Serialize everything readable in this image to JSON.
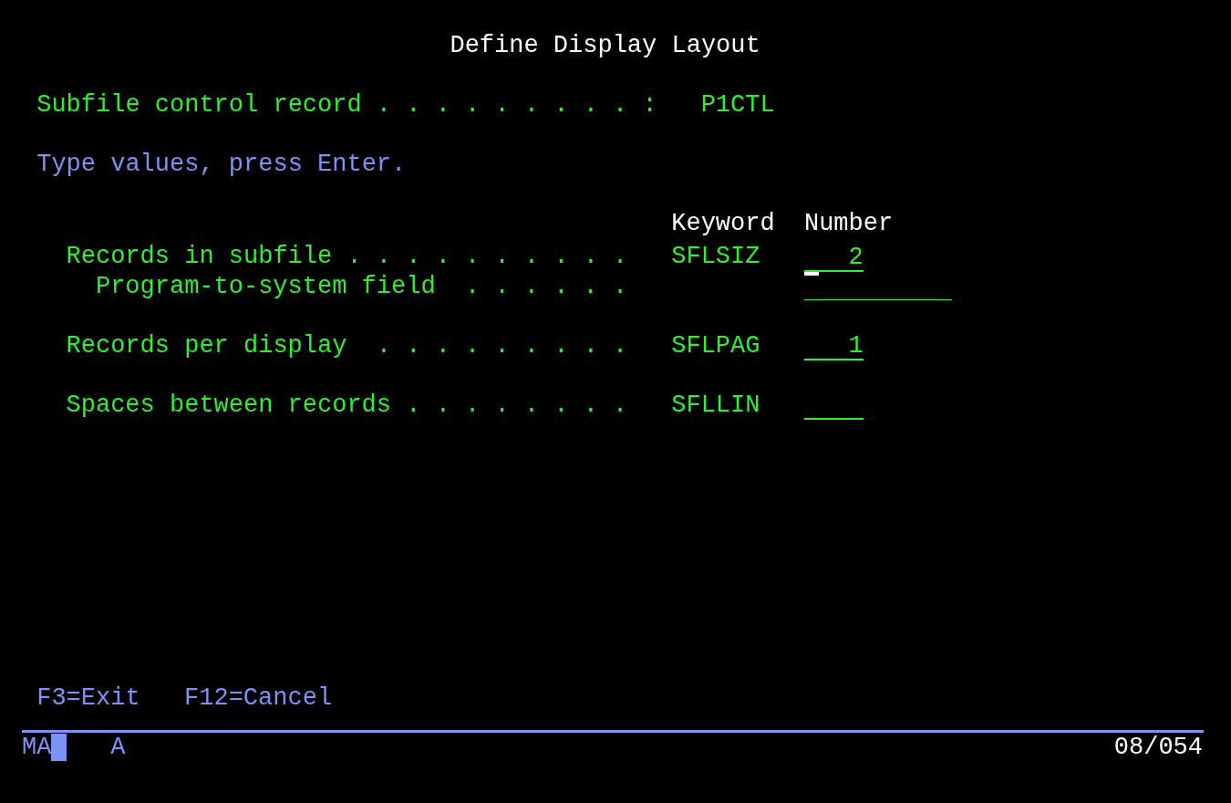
{
  "title": "Define Display Layout",
  "header": {
    "label": "Subfile control record . . . . . . . . . :",
    "value": "P1CTL"
  },
  "instruction": "Type values, press Enter.",
  "columns": [
    "Keyword",
    "Number"
  ],
  "rows": [
    {
      "label": "Records in subfile . . . . . . . . . .",
      "keyword": "SFLSIZ",
      "value": "2",
      "kind": "short",
      "focused": true,
      "children": [
        {
          "label": "Program-to-system field  . . . . . .",
          "kind": "long",
          "focused": false
        }
      ]
    },
    {
      "label": "Records per display  . . . . . . . . .",
      "keyword": "SFLPAG",
      "value": "1",
      "kind": "short",
      "focused": false
    },
    {
      "label": "Spaces between records . . . . . . . .",
      "keyword": "SFLLIN",
      "kind": "short",
      "focused": false
    }
  ],
  "function_keys": [
    "F3=Exit",
    "F12=Cancel"
  ],
  "status_bar": {
    "mode": "MA",
    "insert_indicator": "A",
    "cursor_position": "08/054"
  }
}
